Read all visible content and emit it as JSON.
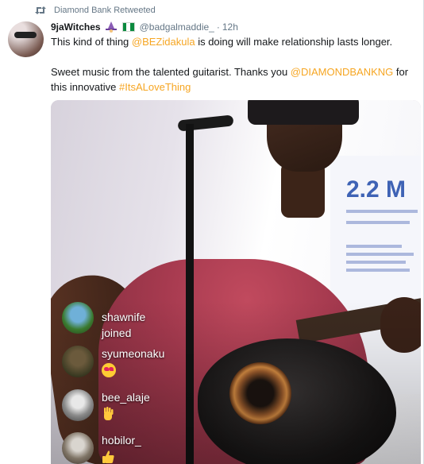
{
  "retweet": {
    "text": "Diamond Bank Retweeted"
  },
  "tweet": {
    "display_name": "9jaWitches",
    "handle": "@badgalmaddie_",
    "separator": "·",
    "time": "12h",
    "line1": {
      "pre": "This kind of thing ",
      "mention": "@BEZidakula",
      "post": " is doing will make relationship lasts longer."
    },
    "line2": {
      "pre": "Sweet music from the talented guitarist.  Thanks you ",
      "mention": "@DIAMONDBANKNG",
      "mid": " for",
      "pre2": "this innovative ",
      "hashtag": "#ItsALoveThing"
    }
  },
  "media": {
    "banner_text": "2.2 M",
    "comments": [
      {
        "user": "shawnife joined",
        "emoji": ""
      },
      {
        "user": "syumeonaku",
        "emoji": "heart-eyes"
      },
      {
        "user": "bee_alaje",
        "emoji": "wave"
      },
      {
        "user": "hobilor_",
        "emoji": "thumbs-up"
      }
    ]
  },
  "colors": {
    "link": "#f6a623",
    "muted": "#657786",
    "text": "#14171a"
  }
}
